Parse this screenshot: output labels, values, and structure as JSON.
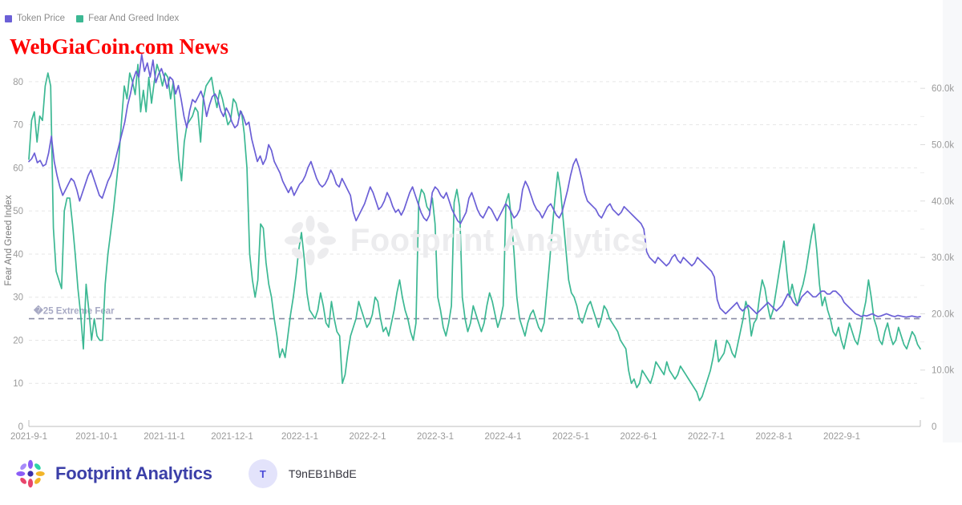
{
  "overlay": {
    "title": "WebGiaCoin.com News",
    "color": "#fe0000"
  },
  "watermark": {
    "text": "Footprint Analytics"
  },
  "legend": {
    "items": [
      {
        "label": "Token Price",
        "color": "#6b5fd6",
        "icon": "square-swatch"
      },
      {
        "label": "Fear And Greed Index",
        "color": "#3cb893",
        "icon": "square-swatch"
      }
    ]
  },
  "footer": {
    "brand": "Footprint Analytics",
    "logo_icon": "pinwheel-logo-icon",
    "avatar_initial": "T",
    "user_name": "T9nEB1hBdE"
  },
  "chart_data": {
    "type": "line",
    "title": "",
    "xlabel": "",
    "ylabel": "Fear And Greed Index",
    "y2label": "",
    "grid": true,
    "legend_position": "top-left",
    "xlim": [
      "2021-9-1",
      "2022-9-22"
    ],
    "ylim": [
      0,
      85
    ],
    "y2lim": [
      0,
      65000
    ],
    "yticks": [
      0,
      10,
      20,
      30,
      40,
      50,
      60,
      70,
      80
    ],
    "ytick_labels": [
      "0",
      "10",
      "20",
      "30",
      "40",
      "50",
      "60",
      "70",
      "80"
    ],
    "y2ticks": [
      0,
      10000,
      20000,
      30000,
      40000,
      50000,
      60000
    ],
    "y2tick_labels": [
      "0",
      "10.0k",
      "20.0k",
      "30.0k",
      "40.0k",
      "50.0k",
      "60.0k"
    ],
    "xticks": [
      "2021-9-1",
      "2021-10-1",
      "2021-11-1",
      "2021-12-1",
      "2022-1-1",
      "2022-2-1",
      "2022-3-1",
      "2022-4-1",
      "2022-5-1",
      "2022-6-1",
      "2022-7-1",
      "2022-8-1",
      "2022-9-1"
    ],
    "annotations": [
      {
        "name": "extreme-fear-threshold",
        "text": "�25 Extreme Fear",
        "value": 25,
        "style": "dashed",
        "color": "#8a8ca6"
      }
    ],
    "series": [
      {
        "name": "Fear And Greed Index",
        "color": "#3cb893",
        "axis": "left",
        "values": [
          62,
          71,
          73,
          66,
          72,
          71,
          79,
          82,
          79,
          46,
          36,
          34,
          32,
          50,
          53,
          53,
          47,
          40,
          32,
          26,
          18,
          33,
          27,
          20,
          25,
          21,
          20,
          20,
          33,
          40,
          45,
          50,
          56,
          62,
          71,
          79,
          76,
          82,
          80,
          77,
          84,
          73,
          78,
          73,
          81,
          75,
          80,
          84,
          82,
          79,
          82,
          81,
          76,
          80,
          71,
          62,
          57,
          66,
          70,
          71,
          72,
          74,
          73,
          66,
          76,
          79,
          80,
          81,
          77,
          74,
          78,
          76,
          73,
          70,
          71,
          76,
          75,
          72,
          73,
          68,
          60,
          40,
          34,
          30,
          34,
          47,
          46,
          38,
          33,
          30,
          25,
          21,
          16,
          18,
          16,
          21,
          26,
          30,
          35,
          41,
          45,
          39,
          31,
          27,
          26,
          25,
          27,
          31,
          28,
          24,
          23,
          29,
          25,
          22,
          21,
          10,
          12,
          17,
          21,
          23,
          25,
          29,
          27,
          25,
          23,
          24,
          26,
          30,
          29,
          25,
          22,
          23,
          21,
          24,
          27,
          31,
          34,
          30,
          27,
          25,
          22,
          20,
          24,
          52,
          55,
          54,
          51,
          50,
          53,
          47,
          30,
          27,
          23,
          21,
          24,
          28,
          52,
          55,
          51,
          30,
          25,
          22,
          24,
          28,
          26,
          24,
          22,
          24,
          28,
          31,
          29,
          26,
          23,
          25,
          28,
          52,
          54,
          48,
          40,
          30,
          25,
          23,
          21,
          24,
          26,
          27,
          25,
          23,
          22,
          24,
          31,
          38,
          46,
          53,
          59,
          55,
          48,
          41,
          34,
          31,
          30,
          28,
          25,
          24,
          26,
          28,
          29,
          27,
          25,
          23,
          25,
          28,
          27,
          25,
          24,
          23,
          22,
          20,
          19,
          18,
          13,
          10,
          11,
          9,
          10,
          13,
          12,
          11,
          10,
          12,
          15,
          14,
          13,
          12,
          15,
          13,
          12,
          11,
          12,
          14,
          13,
          12,
          11,
          10,
          9,
          8,
          6,
          7,
          9,
          11,
          13,
          16,
          20,
          15,
          16,
          17,
          20,
          19,
          17,
          16,
          19,
          22,
          25,
          29,
          27,
          21,
          24,
          25,
          30,
          34,
          32,
          28,
          25,
          27,
          31,
          35,
          39,
          43,
          36,
          30,
          33,
          30,
          28,
          31,
          33,
          36,
          40,
          44,
          47,
          41,
          33,
          28,
          30,
          27,
          25,
          22,
          21,
          23,
          20,
          18,
          21,
          24,
          22,
          20,
          19,
          22,
          26,
          29,
          34,
          30,
          25,
          23,
          20,
          19,
          22,
          24,
          21,
          19,
          20,
          23,
          21,
          19,
          18,
          20,
          22,
          21,
          19,
          18
        ]
      },
      {
        "name": "Token Price",
        "color": "#6b5fd6",
        "axis": "right",
        "values": [
          47000,
          47500,
          48500,
          46800,
          47200,
          46200,
          46500,
          48500,
          51500,
          47000,
          44500,
          42500,
          41000,
          42000,
          43000,
          44000,
          43500,
          42000,
          40000,
          41500,
          43000,
          44500,
          45500,
          44000,
          42500,
          41000,
          40500,
          42000,
          43500,
          44500,
          46000,
          48000,
          50000,
          52000,
          54000,
          57000,
          59000,
          61500,
          63000,
          62000,
          66000,
          63000,
          64500,
          62000,
          65000,
          61000,
          62500,
          63500,
          62000,
          60000,
          62000,
          61500,
          59000,
          60500,
          58000,
          55000,
          53000,
          56000,
          58000,
          57500,
          58500,
          59500,
          58000,
          55000,
          57000,
          58500,
          59000,
          58000,
          56000,
          55000,
          56500,
          55500,
          54000,
          53000,
          53500,
          56000,
          55000,
          53500,
          54000,
          51000,
          49000,
          47000,
          48000,
          46500,
          47500,
          50000,
          49000,
          47000,
          46000,
          45000,
          43500,
          42500,
          41500,
          42500,
          41000,
          42000,
          43000,
          43500,
          44500,
          46000,
          47000,
          45500,
          44000,
          43000,
          42500,
          43000,
          44000,
          45500,
          44500,
          43000,
          42500,
          44000,
          43000,
          42000,
          41000,
          38000,
          36500,
          37500,
          38500,
          39500,
          41000,
          42500,
          41500,
          40000,
          38500,
          39000,
          40000,
          41500,
          40500,
          39000,
          38000,
          38500,
          37500,
          38500,
          40000,
          41500,
          42500,
          41000,
          39500,
          38000,
          37000,
          36500,
          37500,
          41500,
          42500,
          42000,
          41000,
          40500,
          41500,
          40000,
          38500,
          37500,
          36500,
          36000,
          37000,
          38000,
          40500,
          41500,
          40000,
          38500,
          37500,
          37000,
          38000,
          39000,
          38500,
          37500,
          36500,
          37500,
          38500,
          39500,
          39000,
          38000,
          37000,
          37500,
          38500,
          42000,
          43500,
          42500,
          41000,
          39500,
          38500,
          38000,
          37000,
          38000,
          39000,
          39500,
          38500,
          37500,
          37000,
          38000,
          40000,
          42000,
          44500,
          46500,
          47500,
          46000,
          44000,
          41500,
          40000,
          39500,
          39000,
          38500,
          37500,
          37000,
          38000,
          39000,
          39500,
          38500,
          38000,
          37500,
          38000,
          39000,
          38500,
          38000,
          37500,
          37000,
          36500,
          36000,
          35000,
          31000,
          30000,
          29500,
          29000,
          30000,
          29500,
          29000,
          28500,
          29000,
          30000,
          30500,
          29500,
          29000,
          30000,
          29500,
          29000,
          28500,
          29000,
          30000,
          29500,
          29000,
          28500,
          28000,
          27500,
          26500,
          22500,
          21000,
          20500,
          20000,
          20500,
          21000,
          21500,
          22000,
          21000,
          20500,
          21000,
          21500,
          21000,
          20500,
          20000,
          20500,
          21000,
          21500,
          22000,
          21500,
          21000,
          20500,
          21000,
          21500,
          22500,
          23500,
          23000,
          22000,
          21500,
          22000,
          23000,
          23500,
          24000,
          23500,
          23000,
          23000,
          23500,
          24000,
          24000,
          23500,
          23500,
          24000,
          24000,
          23500,
          23000,
          22000,
          21500,
          21000,
          20500,
          20000,
          19800,
          19500,
          19700,
          19600,
          19800,
          20000,
          19700,
          19500,
          19600,
          19800,
          20000,
          19800,
          19600,
          19500,
          19700,
          19600,
          19500,
          19400,
          19500,
          19600,
          19500,
          19400,
          19500
        ]
      }
    ]
  }
}
